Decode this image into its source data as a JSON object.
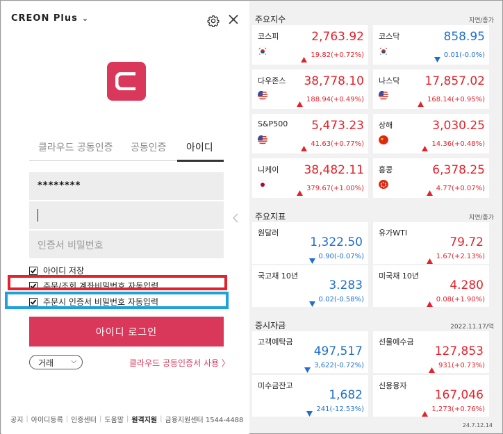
{
  "app": {
    "brand": "CREON Plus",
    "version": "24.7.12.14"
  },
  "login": {
    "tabs": [
      "클라우드 공동인증",
      "공동인증",
      "아이디"
    ],
    "active_tab": 2,
    "password_value": "********",
    "id_value": "",
    "cert_password_placeholder": "인증서 비밀번호",
    "checkboxes": [
      {
        "label": "아이디 저장",
        "checked": true
      },
      {
        "label": "주문/조회 계좌비밀번호 자동입력",
        "checked": true
      },
      {
        "label": "주문시 인증서 비밀번호 자동입력",
        "checked": true
      }
    ],
    "login_button": "아이디 로그인",
    "mode_select": "거래",
    "cloud_link": "클라우드 공동인증서 사용 〉"
  },
  "footer": {
    "items": [
      "공지",
      "아이디등록",
      "인증센터",
      "도움말",
      "원격지원",
      "금융지원센터 1544-4488"
    ]
  },
  "indices": {
    "title": "주요지수",
    "sub": "지연/종가",
    "items": [
      {
        "name": "코스피",
        "value": "2,763.92",
        "change": "19.82(+0.72%)",
        "dir": "up",
        "flag": "kr"
      },
      {
        "name": "코스닥",
        "value": "858.95",
        "change": "0.01(-0.0%)",
        "dir": "down",
        "flag": "kr"
      },
      {
        "name": "다우존스",
        "value": "38,778.10",
        "change": "188.94(+0.49%)",
        "dir": "up",
        "flag": "us"
      },
      {
        "name": "나스닥",
        "value": "17,857.02",
        "change": "168.14(+0.95%)",
        "dir": "up",
        "flag": "us"
      },
      {
        "name": "S&P500",
        "value": "5,473.23",
        "change": "41.63(+0.77%)",
        "dir": "up",
        "flag": "us"
      },
      {
        "name": "상해",
        "value": "3,030.25",
        "change": "14.36(+0.48%)",
        "dir": "up",
        "flag": "cn"
      },
      {
        "name": "니케이",
        "value": "38,482.11",
        "change": "379.67(+1.00%)",
        "dir": "up",
        "flag": "jp"
      },
      {
        "name": "홍콩",
        "value": "6,378.25",
        "change": "4.77(+0.07%)",
        "dir": "up",
        "flag": "hk"
      }
    ]
  },
  "indicators": {
    "title": "주요지표",
    "sub": "지연/종가",
    "items": [
      {
        "name": "원달러",
        "value": "1,322.50",
        "change": "0.90(-0.07%)",
        "dir": "down"
      },
      {
        "name": "유가WTI",
        "value": "79.72",
        "change": "1.67(+2.13%)",
        "dir": "up"
      },
      {
        "name": "국고채 10년",
        "value": "3.283",
        "change": "0.02(-0.58%)",
        "dir": "down"
      },
      {
        "name": "미국채 10년",
        "value": "4.280",
        "change": "0.08(+1.90%)",
        "dir": "up"
      }
    ]
  },
  "funds": {
    "title": "증시자금",
    "sub": "2022.11.17/억",
    "items": [
      {
        "name": "고객예탁금",
        "value": "497,517",
        "change": "3,622(-0.72%)",
        "dir": "down"
      },
      {
        "name": "선물예수금",
        "value": "127,853",
        "change": "931(+0.73%)",
        "dir": "up"
      },
      {
        "name": "미수금잔고",
        "value": "1,682",
        "change": "241(-12.53%)",
        "dir": "down"
      },
      {
        "name": "신용융자",
        "value": "167,046",
        "change": "1,273(+0.76%)",
        "dir": "up"
      }
    ]
  },
  "colors": {
    "brand": "#d9385a",
    "up": "#e5222b",
    "down": "#1f6fd1",
    "highlight_red": "#e3232b",
    "highlight_blue": "#1fa1dc"
  }
}
